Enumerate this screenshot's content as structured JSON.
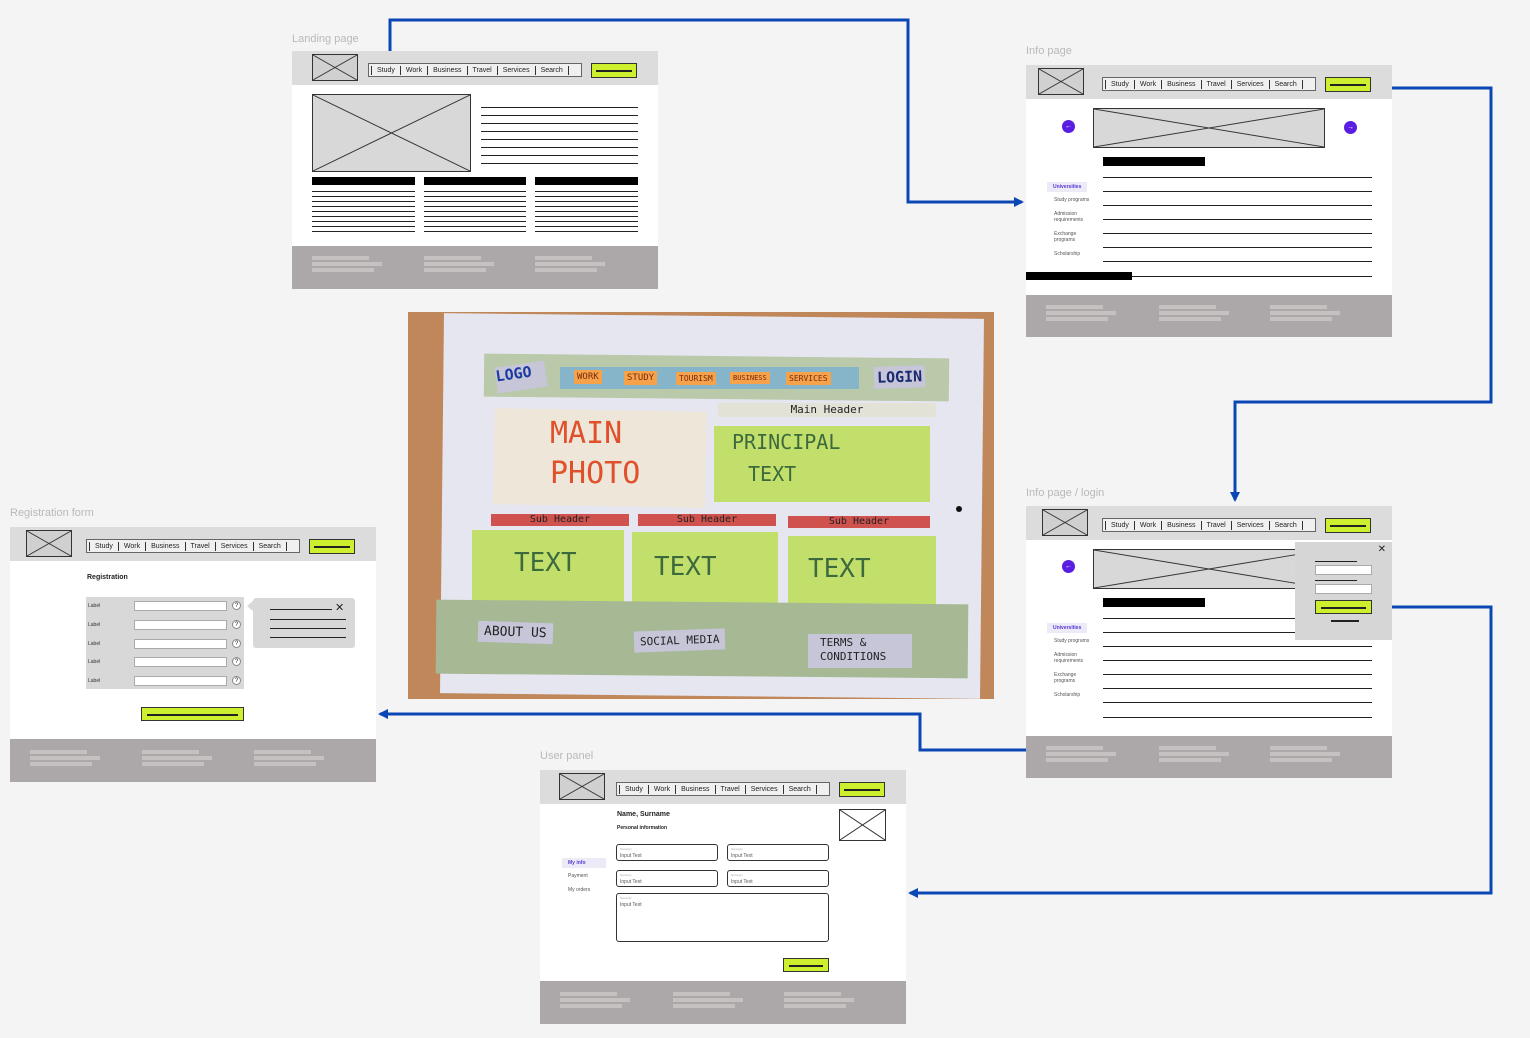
{
  "colors": {
    "accent": "#ccf02e",
    "arrow": "#0a47b5",
    "purple": "#5a1ee3",
    "footer": "#aca7a8"
  },
  "nav": [
    "Study",
    "Work",
    "Business",
    "Travel",
    "Services",
    "Search"
  ],
  "landing": {
    "title": "Landing page"
  },
  "info": {
    "title": "Info page",
    "prev_icon": "arrow-left-icon",
    "next_icon": "arrow-right-icon",
    "side": [
      "Universities",
      "Study programs",
      "Admission requirements",
      "Exchange programs",
      "Scholarship"
    ]
  },
  "login": {
    "title": "Info page / login",
    "close": "✕"
  },
  "registration": {
    "title": "Registration form",
    "heading": "Registration",
    "labels": [
      "Label",
      "Label",
      "Label",
      "Label",
      "Label"
    ],
    "help": "?",
    "close": "✕"
  },
  "user": {
    "title": "User panel",
    "name": "Name, Surname",
    "subtitle": "Personal information",
    "side": [
      "My info",
      "Payment",
      "My orders"
    ],
    "field_label": "Name(s)",
    "field_value": "Input Text"
  },
  "sketch": {
    "logo": "LOGO",
    "nav": [
      "WORK",
      "STUDY",
      "TOURISM",
      "BUSINESS",
      "SERVICES"
    ],
    "login": "LOGIN",
    "main_photo_1": "MAIN",
    "main_photo_2": "PHOTO",
    "main_header": "Main Header",
    "principal_1": "PRINCIPAL",
    "principal_2": "TEXT",
    "sub_header": "Sub Header",
    "text": "TEXT",
    "about": "ABOUT US",
    "social": "SOCIAL MEDIA",
    "terms_1": "TERMS &",
    "terms_2": "CONDITIONS"
  }
}
